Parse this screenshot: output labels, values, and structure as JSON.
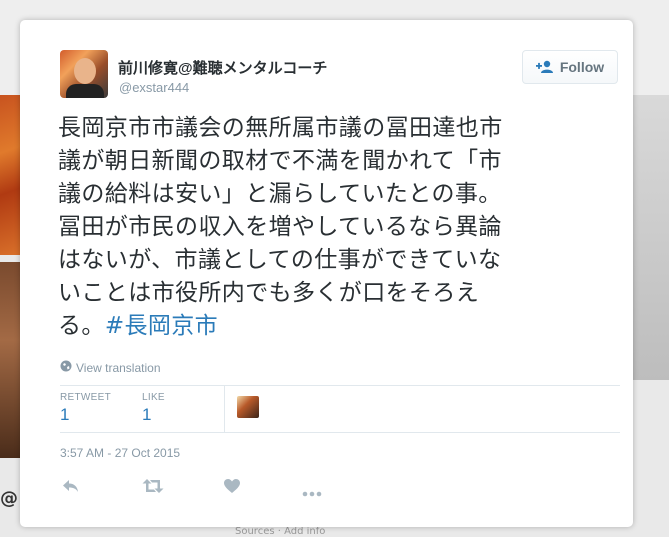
{
  "background": {
    "bottom_left_text": "@",
    "bottom_text": "Sources · Add info"
  },
  "tweet": {
    "display_name": "前川修寛@難聴メンタルコーチ",
    "handle": "@exstar444",
    "follow_label": "Follow",
    "text_lines": [
      "長岡京市市議会の無所属市議の冨田達也市",
      "議が朝日新聞の取材で不満を聞かれて「市",
      "議の給料は安い」と漏らしていたとの事。",
      "冨田が市民の収入を増やしているなら異論",
      "はないが、市議としての仕事ができていな",
      "いことは市役所内でも多くが口をそろえ"
    ],
    "last_line_prefix": "る。",
    "hashtag": "#長岡京市",
    "translate_label": "View translation",
    "retweet_label": "RETWEET",
    "retweet_count": "1",
    "like_label": "LIKE",
    "like_count": "1",
    "timestamp": "3:57 AM - 27 Oct 2015"
  },
  "colors": {
    "link": "#2b7bb9",
    "muted": "#8899a6",
    "text": "#292f33"
  },
  "icons": [
    "follow-person-plus-icon",
    "globe-icon",
    "reply-icon",
    "retweet-icon",
    "heart-icon",
    "more-icon"
  ]
}
